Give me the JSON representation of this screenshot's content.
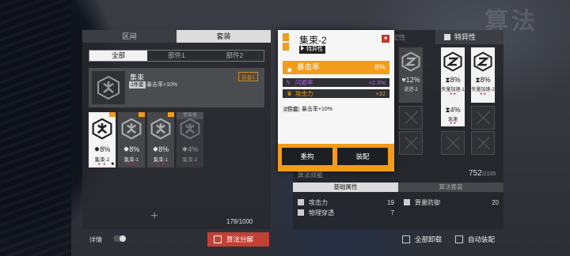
{
  "left_tabs": [
    {
      "label": "区间",
      "active": false
    },
    {
      "label": "套装",
      "active": true
    }
  ],
  "filters": [
    {
      "label": "全部",
      "active": true
    },
    {
      "label": "部件1",
      "active": false
    },
    {
      "label": "部件2",
      "active": false
    }
  ],
  "detail": {
    "name": "集束",
    "set_badge": "2件套",
    "set_effect": "暴击率+10%",
    "equipped_tag": "装备1"
  },
  "cards": [
    {
      "stat": "8%",
      "name": "集束-2",
      "dots": "● ●",
      "selected": true,
      "lock": "🔒",
      "orange": true
    },
    {
      "stat": "8%",
      "name": "集束-1",
      "dots": "● ●",
      "selected": false,
      "orange": true
    },
    {
      "stat": "8%",
      "name": "集束-1",
      "dots": "● ●",
      "selected": false,
      "orange": true
    },
    {
      "stat": "4%",
      "name": "集束-2",
      "dots": "● ●",
      "selected": false,
      "orange": false,
      "ribbon": "使装备"
    }
  ],
  "count": "178/1000",
  "bottom_left": {
    "detail_label": "详情",
    "decompose_label": "算法分解"
  },
  "popup": {
    "title": "集束-2",
    "subtitle": "特异性",
    "main_stat": {
      "label": "暴击率",
      "value": "8%"
    },
    "sub_stats": [
      {
        "label": "闪避率",
        "value": "+2.3%",
        "color": "#b46ae6"
      },
      {
        "label": "攻击力",
        "value": "+32",
        "color": "#f39c19"
      }
    ],
    "set_badge": "2件套",
    "set_effect": "暴击率+10%",
    "buttons": {
      "rebuild": "重构",
      "equip": "装配"
    }
  },
  "right": {
    "feature_tab": "特异性",
    "ghost_tab": "定性",
    "slots": [
      {
        "stat": "12%",
        "name": "迸逆-2",
        "white": false
      },
      {
        "stat": "8%",
        "name": "矢量加速-1",
        "white": true
      },
      {
        "stat": "8%",
        "name": "矢量加速-2",
        "white": true
      },
      {
        "stat": "4%",
        "name": "急速",
        "white": true
      }
    ],
    "progress_label": "算法效能",
    "progress_value": "752",
    "progress_max": "/2105",
    "stat_tabs": [
      {
        "label": "基础属性",
        "active": true
      },
      {
        "label": "算法套装",
        "active": false
      }
    ],
    "stats_left": [
      {
        "label": "攻击力",
        "value": "19"
      },
      {
        "label": "物理穿透",
        "value": "7"
      }
    ],
    "stats_right": [
      {
        "label": "算量防御",
        "value": "20"
      }
    ],
    "unequip_all": "全部卸载",
    "auto_equip": "自动装配"
  }
}
